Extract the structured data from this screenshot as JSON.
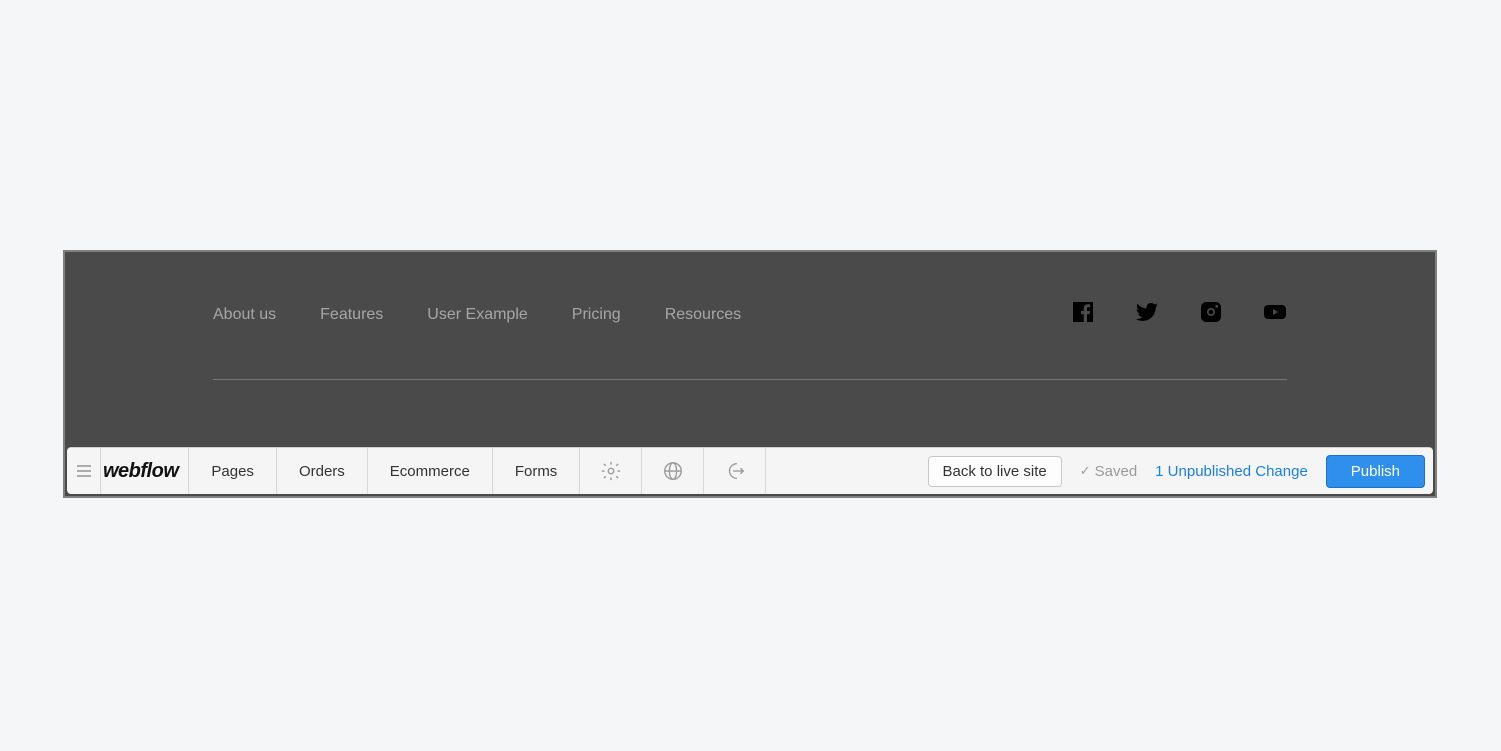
{
  "footer": {
    "links": [
      "About us",
      "Features",
      "User Example",
      "Pricing",
      "Resources"
    ],
    "social": [
      "facebook",
      "twitter",
      "instagram",
      "youtube"
    ]
  },
  "editor": {
    "logo": "webflow",
    "tabs": {
      "pages": "Pages",
      "orders": "Orders",
      "ecommerce": "Ecommerce",
      "forms": "Forms"
    },
    "back_to_live": "Back to live site",
    "saved_label": "Saved",
    "changes_label": "1 Unpublished Change",
    "publish_label": "Publish"
  }
}
